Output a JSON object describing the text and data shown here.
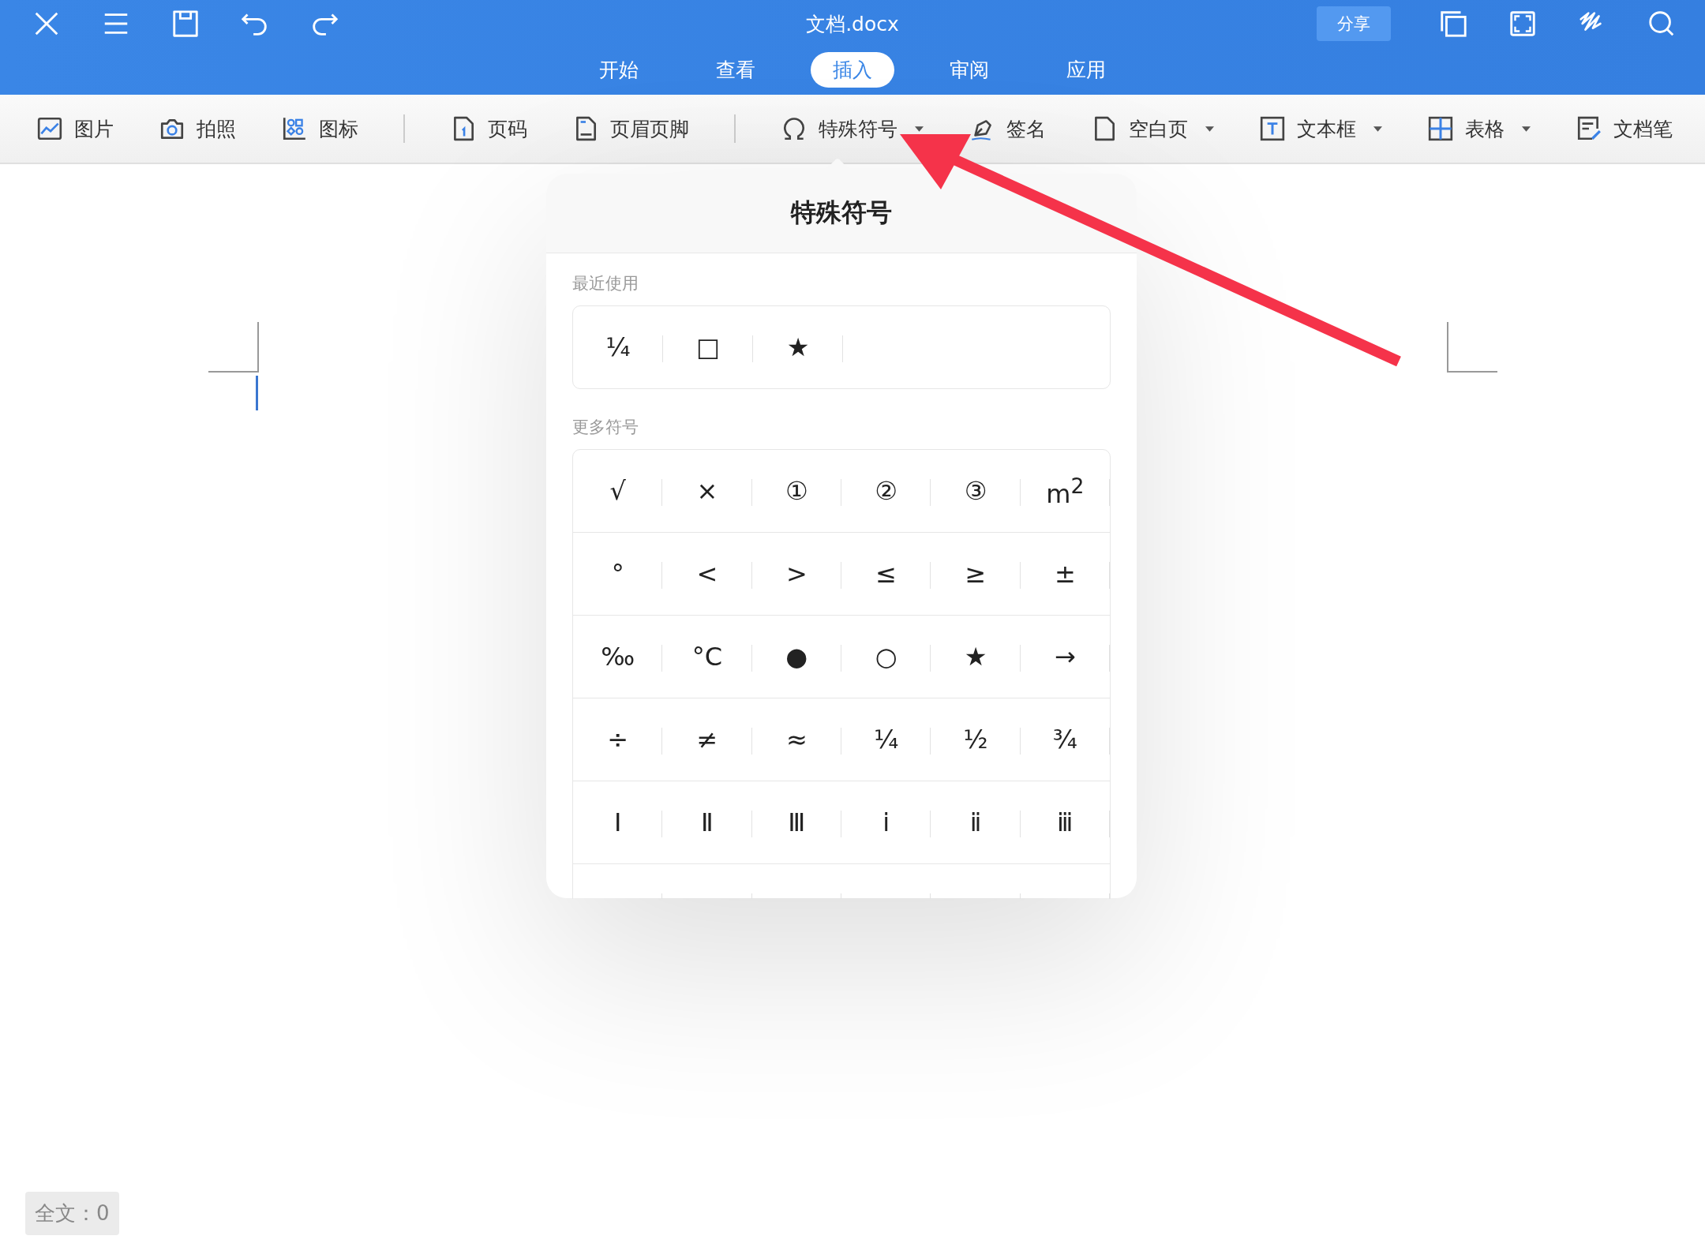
{
  "window": {
    "title": "文档.docx"
  },
  "share_button": "分享",
  "tabs": [
    {
      "label": "开始",
      "selected": false
    },
    {
      "label": "查看",
      "selected": false
    },
    {
      "label": "插入",
      "selected": true
    },
    {
      "label": "审阅",
      "selected": false
    },
    {
      "label": "应用",
      "selected": false
    }
  ],
  "toolbar_groups": [
    [
      {
        "label": "图片",
        "dropdown": false
      },
      {
        "label": "拍照",
        "dropdown": false
      },
      {
        "label": "图标",
        "dropdown": false
      }
    ],
    [
      {
        "label": "页码",
        "dropdown": false
      },
      {
        "label": "页眉页脚",
        "dropdown": false
      }
    ],
    [
      {
        "label": "特殊符号",
        "dropdown": true
      },
      {
        "label": "签名",
        "dropdown": false
      },
      {
        "label": "空白页",
        "dropdown": true
      },
      {
        "label": "文本框",
        "dropdown": true
      },
      {
        "label": "表格",
        "dropdown": true
      },
      {
        "label": "文档笔",
        "dropdown": false
      }
    ]
  ],
  "popup": {
    "title": "特殊符号",
    "recent": {
      "label": "最近使用",
      "symbols": [
        "¼",
        "□",
        "★"
      ]
    },
    "more": {
      "label": "更多符号",
      "rows": [
        [
          "√",
          "×",
          "①",
          "②",
          "③",
          "m$^{2}$"
        ],
        [
          "°",
          "<",
          ">",
          "≤",
          "≥",
          "±"
        ],
        [
          "‰",
          "°C",
          "●",
          "○",
          "★",
          "→"
        ],
        [
          "÷",
          "≠",
          "≈",
          "¼",
          "½",
          "¾"
        ],
        [
          "Ⅰ",
          "Ⅱ",
          "Ⅲ",
          "ⅰ",
          "ⅱ",
          "ⅲ"
        ]
      ]
    }
  },
  "status": {
    "word_count": "全文：0"
  }
}
